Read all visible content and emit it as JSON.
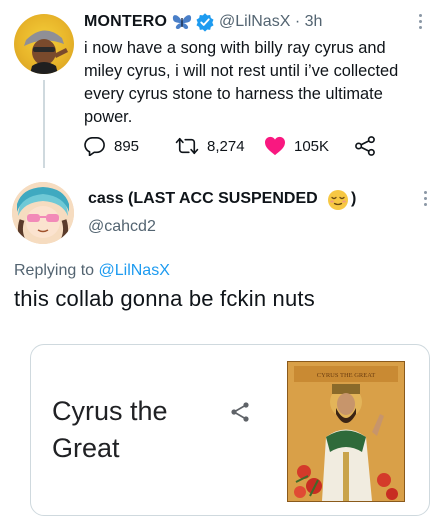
{
  "tweet": {
    "author_name": "MONTERO",
    "handle": "@LilNasX",
    "separator": "·",
    "time": "3h",
    "text": "i now have a song with billy ray cyrus and miley cyrus, i will not rest until i’ve collected every cyrus stone to harness the ultimate power.",
    "replies": "895",
    "retweets": "8,274",
    "likes": "105K",
    "icons": [
      "butterfly-icon",
      "verified-badge-icon",
      "more-icon",
      "reply-icon",
      "retweet-icon",
      "heart-icon",
      "share-icon"
    ],
    "colors": {
      "like": "#f91880",
      "verified": "#1d9bf0",
      "secondary_text": "#536471"
    }
  },
  "reply": {
    "author_name": "cass (LAST ACC SUSPENDED",
    "author_emoji": "relieved-face-emoji",
    "author_close": ")",
    "handle": "@cahcd2",
    "replying_prefix": "Replying to",
    "replying_to": "@LilNasX",
    "text": "this collab gonna be fckin nuts"
  },
  "card": {
    "title": "Cyrus the Great",
    "image_caption": "CYRUS THE GREAT",
    "icons": [
      "share-icon",
      "painting-image"
    ]
  }
}
